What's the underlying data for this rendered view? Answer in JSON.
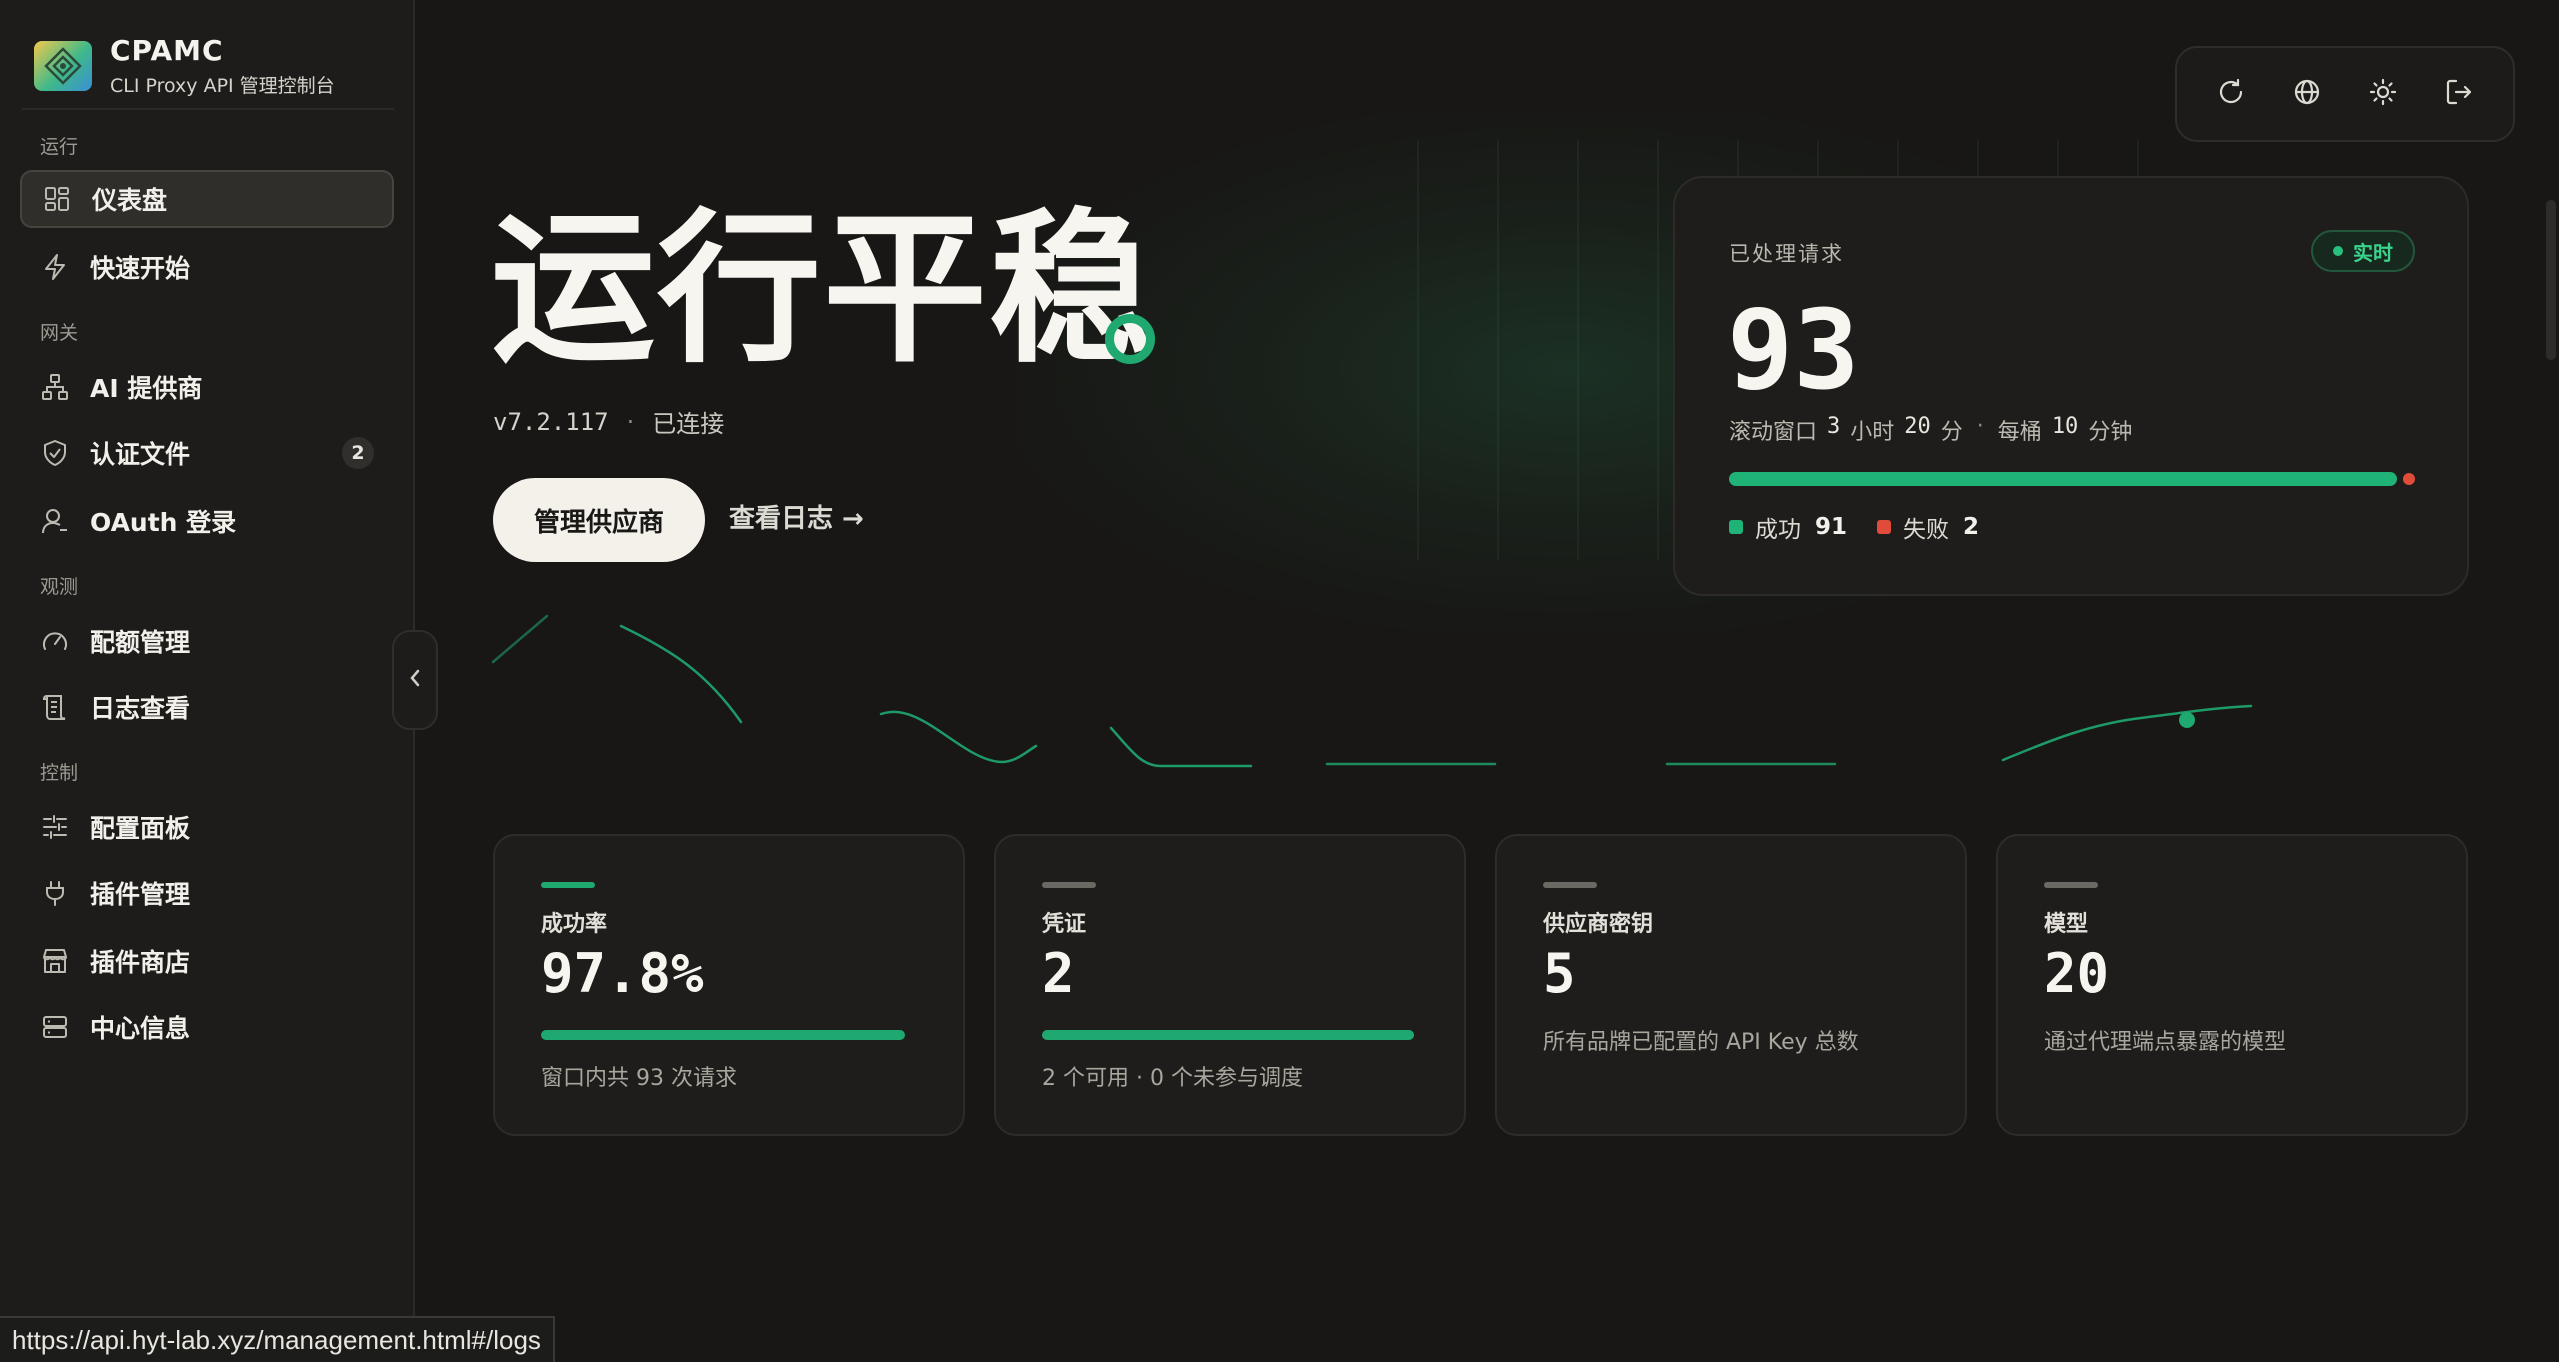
{
  "brand": {
    "name": "CPAMC",
    "subtitle": "CLI Proxy API 管理控制台"
  },
  "sidebar": {
    "sections": {
      "run": "运行",
      "gateway": "网关",
      "observe": "观测",
      "control": "控制"
    },
    "items": [
      {
        "label": "仪表盘",
        "icon": "dashboard-icon",
        "active": true
      },
      {
        "label": "快速开始",
        "icon": "lightning-icon"
      },
      {
        "label": "AI 提供商",
        "icon": "network-icon"
      },
      {
        "label": "认证文件",
        "icon": "shield-icon",
        "badge": "2"
      },
      {
        "label": "OAuth 登录",
        "icon": "user-icon"
      },
      {
        "label": "配额管理",
        "icon": "gauge-icon"
      },
      {
        "label": "日志查看",
        "icon": "scroll-icon"
      },
      {
        "label": "配置面板",
        "icon": "sliders-icon"
      },
      {
        "label": "插件管理",
        "icon": "plug-icon"
      },
      {
        "label": "插件商店",
        "icon": "store-icon"
      },
      {
        "label": "中心信息",
        "icon": "server-icon"
      }
    ]
  },
  "toolbar": {
    "icons": [
      "refresh-icon",
      "globe-icon",
      "sun-icon",
      "logout-icon"
    ]
  },
  "hero": {
    "title": "运行平稳",
    "version": "v7.2.117",
    "separator": "·",
    "status": "已连接",
    "primary_button": "管理供应商",
    "secondary_link": "查看日志 →"
  },
  "requests": {
    "label": "已处理请求",
    "live_badge": "实时",
    "value": "93",
    "window_prefix": "滚动窗口",
    "window_hours": "3",
    "hours_unit": "小时",
    "window_minutes": "20",
    "minutes_unit": "分",
    "sep": "·",
    "bucket_prefix": "每桶",
    "bucket_minutes": "10",
    "bucket_unit": "分钟",
    "success_label": "成功",
    "success_count": "91",
    "fail_label": "失败",
    "fail_count": "2",
    "success_fraction": 0.978,
    "colors": {
      "success": "#1fb377",
      "fail": "#e14c3a"
    }
  },
  "stats": [
    {
      "title": "成功率",
      "value": "97.8%",
      "desc": "窗口内共 93 次请求",
      "bar_fraction": 0.978,
      "accent": "#1fa971"
    },
    {
      "title": "凭证",
      "value": "2",
      "desc": "2 个可用 · 0 个未参与调度",
      "bar_fraction": 1.0,
      "accent": "#6b6964"
    },
    {
      "title": "供应商密钥",
      "value": "5",
      "desc": "所有品牌已配置的 API Key 总数",
      "accent": "#6b6964"
    },
    {
      "title": "模型",
      "value": "20",
      "desc": "通过代理端点暴露的模型",
      "accent": "#6b6964"
    }
  ],
  "status_bar": {
    "url": "https://api.hyt-lab.xyz/management.html#/logs"
  }
}
